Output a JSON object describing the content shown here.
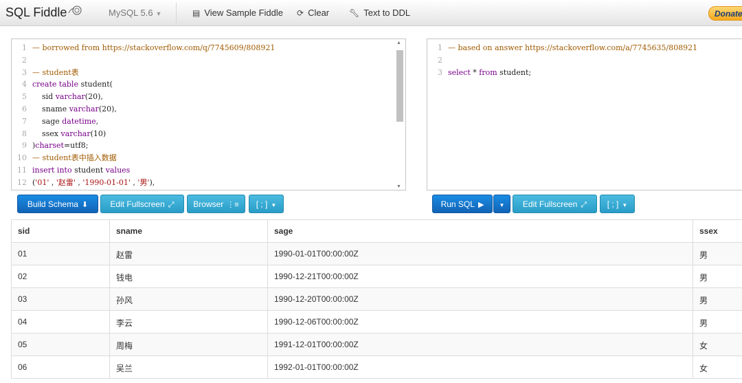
{
  "navbar": {
    "brand": "SQL Fiddle",
    "db_version": "MySQL 5.6",
    "view_sample": "View Sample Fiddle",
    "clear": "Clear",
    "text_to_ddl": "Text to DDL",
    "donate": "Donate"
  },
  "schema_editor": {
    "lines": [
      {
        "n": "1",
        "parts": [
          {
            "c": "c-cm",
            "t": "— borrowed from https://stackoverflow.com/q/7745609/808921"
          }
        ]
      },
      {
        "n": "2",
        "parts": []
      },
      {
        "n": "3",
        "parts": [
          {
            "c": "c-cm",
            "t": "— student"
          },
          {
            "c": "c-zh",
            "t": "表"
          }
        ]
      },
      {
        "n": "4",
        "parts": [
          {
            "c": "c-kw",
            "t": "create table "
          },
          {
            "c": "c-tx",
            "t": "student("
          }
        ]
      },
      {
        "n": "5",
        "parts": [
          {
            "c": "c-tx",
            "t": "    sid "
          },
          {
            "c": "c-kw",
            "t": "varchar"
          },
          {
            "c": "c-tx",
            "t": "(20),"
          }
        ]
      },
      {
        "n": "6",
        "parts": [
          {
            "c": "c-tx",
            "t": "    sname "
          },
          {
            "c": "c-kw",
            "t": "varchar"
          },
          {
            "c": "c-tx",
            "t": "(20),"
          }
        ]
      },
      {
        "n": "7",
        "parts": [
          {
            "c": "c-tx",
            "t": "    sage "
          },
          {
            "c": "c-kw",
            "t": "datetime"
          },
          {
            "c": "c-tx",
            "t": ","
          }
        ]
      },
      {
        "n": "8",
        "parts": [
          {
            "c": "c-tx",
            "t": "    ssex "
          },
          {
            "c": "c-kw",
            "t": "varchar"
          },
          {
            "c": "c-tx",
            "t": "(10)"
          }
        ]
      },
      {
        "n": "9",
        "parts": [
          {
            "c": "c-tx",
            "t": ")"
          },
          {
            "c": "c-kw",
            "t": "charset"
          },
          {
            "c": "c-tx",
            "t": "=utf8;"
          }
        ]
      },
      {
        "n": "10",
        "parts": [
          {
            "c": "c-cm",
            "t": "— student"
          },
          {
            "c": "c-zh",
            "t": "表中插入数据"
          }
        ]
      },
      {
        "n": "11",
        "parts": [
          {
            "c": "c-kw",
            "t": "insert into "
          },
          {
            "c": "c-tx",
            "t": "student "
          },
          {
            "c": "c-kw",
            "t": "values"
          }
        ]
      },
      {
        "n": "12",
        "parts": [
          {
            "c": "c-tx",
            "t": "("
          },
          {
            "c": "c-st",
            "t": "'01'"
          },
          {
            "c": "c-tx",
            "t": " , "
          },
          {
            "c": "c-st",
            "t": "'赵雷'"
          },
          {
            "c": "c-tx",
            "t": " , "
          },
          {
            "c": "c-st",
            "t": "'1990-01-01'"
          },
          {
            "c": "c-tx",
            "t": " , "
          },
          {
            "c": "c-st",
            "t": "'男'"
          },
          {
            "c": "c-tx",
            "t": "),"
          }
        ]
      }
    ]
  },
  "query_editor": {
    "lines": [
      {
        "n": "1",
        "parts": [
          {
            "c": "c-cm",
            "t": "— based on answer https://stackoverflow.com/a/7745635/808921"
          }
        ]
      },
      {
        "n": "2",
        "parts": []
      },
      {
        "n": "3",
        "parts": [
          {
            "c": "c-kw",
            "t": "select "
          },
          {
            "c": "c-tx",
            "t": "* "
          },
          {
            "c": "c-kw",
            "t": "from "
          },
          {
            "c": "c-tx",
            "t": "student;"
          }
        ]
      }
    ]
  },
  "buttons": {
    "build_schema": "Build Schema",
    "edit_fullscreen_left": "Edit Fullscreen",
    "browser": "Browser",
    "terminator_left": "[ ; ]",
    "run_sql": "Run SQL",
    "edit_fullscreen_right": "Edit Fullscreen",
    "terminator_right": "[ ; ]"
  },
  "results": {
    "columns": [
      "sid",
      "sname",
      "sage",
      "ssex"
    ],
    "rows": [
      [
        "01",
        "赵雷",
        "1990-01-01T00:00:00Z",
        "男"
      ],
      [
        "02",
        "钱电",
        "1990-12-21T00:00:00Z",
        "男"
      ],
      [
        "03",
        "孙风",
        "1990-12-20T00:00:00Z",
        "男"
      ],
      [
        "04",
        "李云",
        "1990-12-06T00:00:00Z",
        "男"
      ],
      [
        "05",
        "周梅",
        "1991-12-01T00:00:00Z",
        "女"
      ],
      [
        "06",
        "吴兰",
        "1992-01-01T00:00:00Z",
        "女"
      ]
    ]
  }
}
